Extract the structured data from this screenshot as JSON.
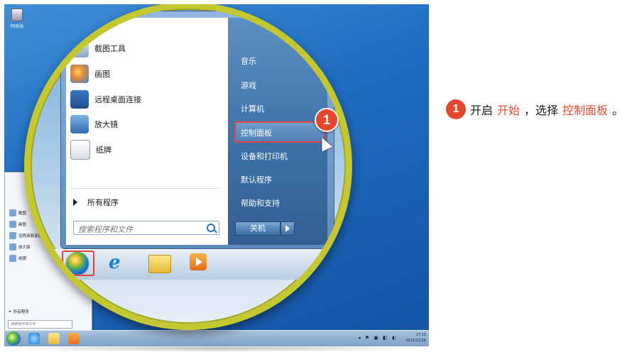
{
  "desktop": {
    "recycle_bin_label": "回收站"
  },
  "start_menu": {
    "programs": [
      {
        "label": "截图工具",
        "icon": "snipping-tool-icon"
      },
      {
        "label": "画图",
        "icon": "paint-icon"
      },
      {
        "label": "远程桌面连接",
        "icon": "remote-desktop-icon"
      },
      {
        "label": "放大镜",
        "icon": "magnifier-icon"
      },
      {
        "label": "纸牌",
        "icon": "solitaire-icon"
      }
    ],
    "all_programs": "所有程序",
    "search_placeholder": "搜索程序和文件",
    "right_items": [
      "音乐",
      "游戏",
      "计算机",
      "控制面板",
      "设备和打印机",
      "默认程序",
      "帮助和支持"
    ],
    "shutdown_label": "关机"
  },
  "small_menu": {
    "programs": [
      "截图",
      "画图",
      "远程桌面连接",
      "放大镜",
      "纸牌"
    ],
    "all_programs": "所有程序",
    "search_placeholder": "搜索程序和文件"
  },
  "taskbar": {
    "clock_time": "17:10",
    "clock_date": "2015/11/16"
  },
  "step": {
    "number": "1",
    "prefix": "开启",
    "highlight1": "开始",
    "middle": "，选择",
    "highlight2": "控制面板",
    "suffix": "。"
  },
  "colors": {
    "accent_red": "#e3472d",
    "lens_ring": "#c5c730",
    "desktop_blue": "#1f6cc0"
  }
}
